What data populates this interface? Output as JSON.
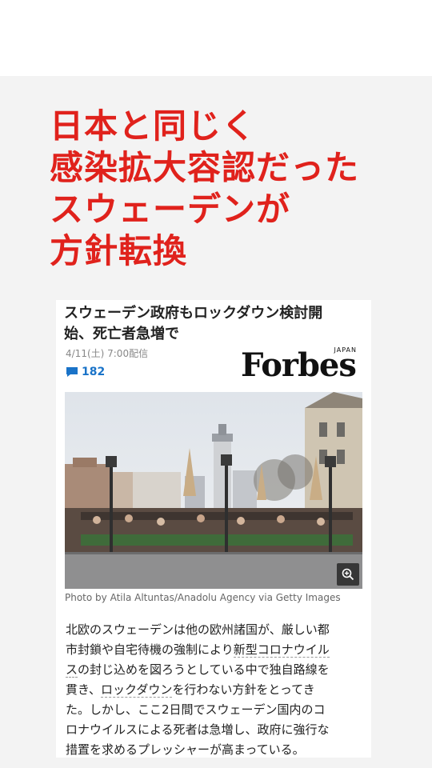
{
  "headline": {
    "lines": [
      "日本と同じく",
      "感染拡大容認だった",
      "スウェーデンが",
      "方針転換"
    ]
  },
  "article": {
    "title_lines": [
      "スウェーデン政府もロックダウン検討開",
      "始、死亡者急増で"
    ],
    "date": "4/11(土) 7:00配信",
    "comment_count": "182",
    "publisher": {
      "name": "Forbes",
      "edition": "JAPAN"
    },
    "photo_caption": "Photo by Atila Altuntas/Anadolu Agency via Getty Images",
    "body": {
      "line1": "北欧のスウェーデンは他の欧州諸国が、厳しい都",
      "line2_a": "市封鎖や自宅待機の強制により",
      "line2_link": "新型コロナウイル",
      "line3_link": "ス",
      "line3_b": "の封じ込めを図ろうとしている中で独自路線を",
      "line4_a": "貫き、",
      "line4_link": "ロックダウン",
      "line4_b": "を行わない方針をとってき",
      "line5": "た。しかし、ここ2日間でスウェーデン国内のコ",
      "line6": "ロナウイルスによる死者は急増し、政府に強行な",
      "line7": "措置を求めるプレッシャーが高まっている。"
    }
  },
  "icons": {
    "comment": "comment-bubble-icon",
    "zoom": "zoom-in-icon"
  },
  "colors": {
    "headline": "#e0221c",
    "comment": "#1a73c8",
    "background": "#f3f3f3"
  }
}
